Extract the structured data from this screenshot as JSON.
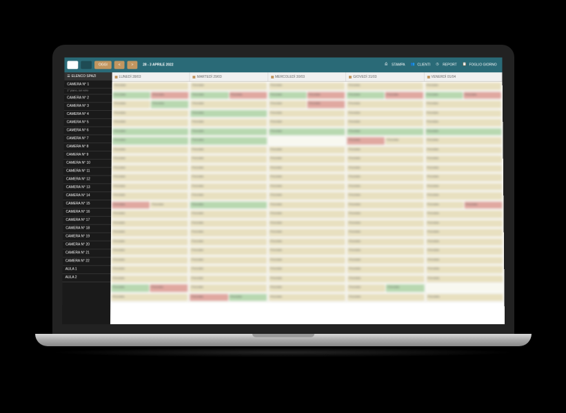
{
  "toolbar": {
    "view1": "",
    "view2": "",
    "today_label": "OGGI",
    "prev_label": "<",
    "next_label": ">",
    "date_range": "28 - 3 APRILE 2022",
    "actions": [
      {
        "icon": "printer-icon",
        "label": "STAMPA"
      },
      {
        "icon": "users-icon",
        "label": "CLIENTI"
      },
      {
        "icon": "clock-icon",
        "label": "REPORT"
      },
      {
        "icon": "clipboard-icon",
        "label": "FOGLIO GIORNO"
      }
    ]
  },
  "sidebar": {
    "header_label": "ELENCO SPAZI",
    "items": [
      {
        "label": "CAMERA N° 1",
        "sub": "1° piano, sul retro"
      },
      {
        "label": "CAMERA N° 2"
      },
      {
        "label": "CAMERA N° 3"
      },
      {
        "label": "CAMERA N° 4"
      },
      {
        "label": "CAMERA N° 5"
      },
      {
        "label": "CAMERA N° 6"
      },
      {
        "label": "CAMERA N° 7"
      },
      {
        "label": "CAMERA N° 8"
      },
      {
        "label": "CAMERA N° 9"
      },
      {
        "label": "CAMERA N° 10"
      },
      {
        "label": "CAMERA N° 11"
      },
      {
        "label": "CAMERA N° 12"
      },
      {
        "label": "CAMERA N° 13"
      },
      {
        "label": "CAMERA N° 14"
      },
      {
        "label": "CAMERA N° 15"
      },
      {
        "label": "CAMERA N° 16"
      },
      {
        "label": "CAMERA N° 17"
      },
      {
        "label": "CAMERA N° 18"
      },
      {
        "label": "CAMERA N° 19"
      },
      {
        "label": "CAMERA N° 20"
      },
      {
        "label": "CAMERA N° 21"
      },
      {
        "label": "CAMERA N° 22"
      },
      {
        "label": "AULA 1"
      },
      {
        "label": "AULA 2"
      }
    ]
  },
  "days": [
    {
      "label": "LUNEDÌ 28/03"
    },
    {
      "label": "MARTEDÌ 29/03"
    },
    {
      "label": "MERCOLEDÌ 30/03"
    },
    {
      "label": "GIOVEDÌ 31/03"
    },
    {
      "label": "VENERDÌ 01/04"
    }
  ],
  "grid": {
    "placeholder_text": "Prenotato",
    "row_patterns": [
      [
        "beige",
        "beige",
        "beige",
        "beige",
        "beige"
      ],
      [
        "green-red",
        "green-red",
        "green-red",
        "green-red",
        "green-red"
      ],
      [
        "beige-green",
        "beige",
        "beige-red",
        "beige",
        "beige"
      ],
      [
        "beige",
        "green",
        "beige",
        "beige",
        "beige"
      ],
      [
        "beige",
        "beige",
        "beige",
        "beige",
        "beige"
      ],
      [
        "green",
        "green",
        "green",
        "green",
        "green"
      ],
      [
        "green",
        "green",
        "empty",
        "red-beige",
        "beige"
      ],
      [
        "beige",
        "beige",
        "beige",
        "beige",
        "beige"
      ],
      [
        "beige",
        "beige",
        "beige",
        "beige",
        "beige"
      ],
      [
        "beige",
        "beige",
        "beige",
        "beige",
        "beige"
      ],
      [
        "beige",
        "beige",
        "beige",
        "beige",
        "beige"
      ],
      [
        "beige",
        "beige",
        "beige",
        "beige",
        "beige"
      ],
      [
        "beige",
        "beige",
        "beige",
        "beige",
        "beige"
      ],
      [
        "red-beige",
        "green",
        "beige",
        "beige",
        "beige-red"
      ],
      [
        "beige",
        "beige",
        "beige",
        "beige",
        "beige"
      ],
      [
        "beige",
        "beige",
        "beige",
        "beige",
        "beige"
      ],
      [
        "beige",
        "beige",
        "beige",
        "beige",
        "beige"
      ],
      [
        "beige",
        "beige",
        "beige",
        "beige",
        "beige"
      ],
      [
        "beige",
        "beige",
        "beige",
        "beige",
        "beige"
      ],
      [
        "beige",
        "beige",
        "beige",
        "beige",
        "beige"
      ],
      [
        "beige",
        "beige",
        "beige",
        "beige",
        "beige"
      ],
      [
        "beige",
        "beige",
        "beige",
        "beige",
        "beige"
      ],
      [
        "green-red",
        "beige",
        "beige",
        "beige-green",
        "empty"
      ],
      [
        "beige",
        "red-green",
        "beige",
        "beige",
        "beige"
      ]
    ]
  },
  "colors": {
    "toolbar_bg": "#2a6a77",
    "accent": "#c19660",
    "sidebar_bg": "#1a1a1a",
    "booking_beige": "#e8e0c0",
    "booking_green": "#b8d8b0",
    "booking_red": "#e0a8a0"
  }
}
